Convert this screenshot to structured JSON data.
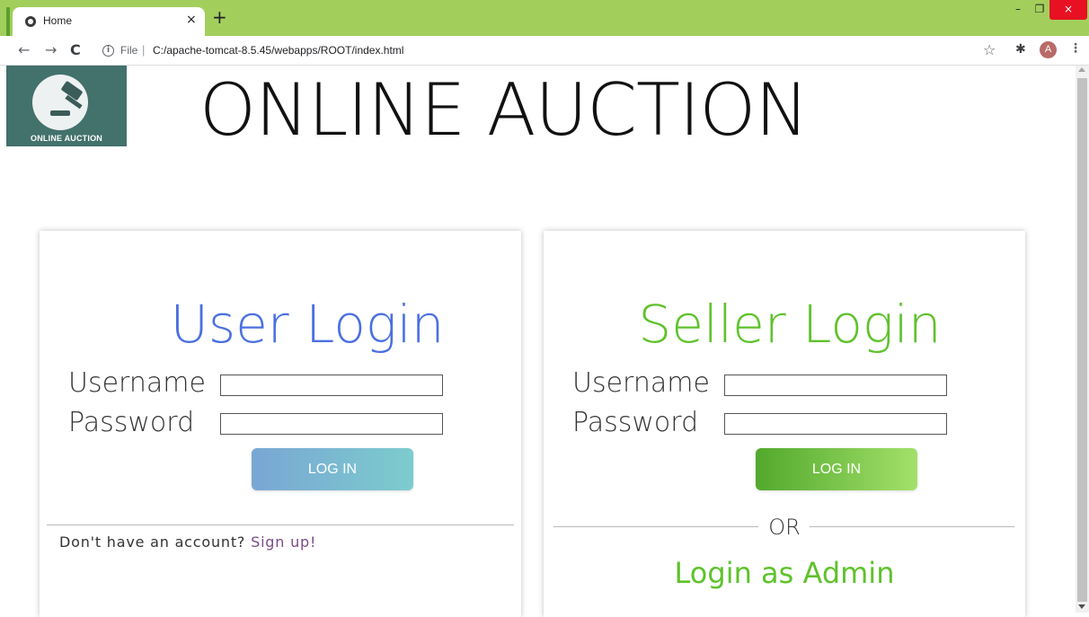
{
  "browser": {
    "tab_title": "Home",
    "tab_close": "×",
    "new_tab": "+",
    "win_min": "–",
    "win_max": "❐",
    "win_close": "×",
    "nav_back": "←",
    "nav_forward": "→",
    "nav_reload": "C",
    "info_icon": "i",
    "url_scheme": "File",
    "url_separator": "|",
    "url": "C:/apache-tomcat-8.5.45/webapps/ROOT/index.html",
    "star": "☆",
    "extensions": "✱",
    "avatar_letter": "A",
    "menu": "⋮",
    "accent_color": "#a2cf5c"
  },
  "header": {
    "logo_text": "ONLINE AUCTION",
    "title": "ONLINE AUCTION"
  },
  "user_login": {
    "title": "User Login",
    "title_color": "#4a70e0",
    "username_label": "Username",
    "password_label": "Password",
    "username_value": "",
    "password_value": "",
    "login_button": "LOG IN",
    "signup_prefix": "Don't have an account? ",
    "signup_link": "Sign up!"
  },
  "seller_login": {
    "title": "Seller Login",
    "title_color": "#5ec22b",
    "username_label": "Username",
    "password_label": "Password",
    "username_value": "",
    "password_value": "",
    "login_button": "LOG IN",
    "or_text": "OR",
    "admin_link": "Login as Admin"
  }
}
